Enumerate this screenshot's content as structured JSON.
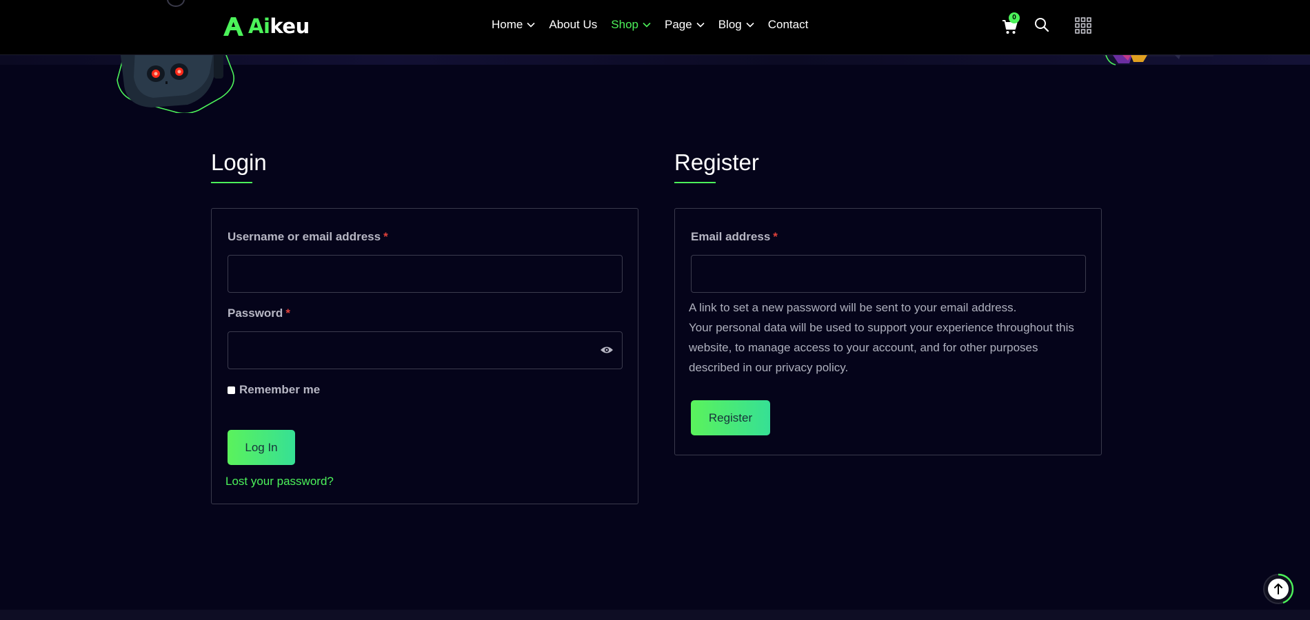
{
  "brand": {
    "logo_prefix": "Ai",
    "logo_suffix": "keu"
  },
  "nav": {
    "items": [
      {
        "label": "Home",
        "has_dropdown": true,
        "active": false
      },
      {
        "label": "About Us",
        "has_dropdown": false,
        "active": false
      },
      {
        "label": "Shop",
        "has_dropdown": true,
        "active": true
      },
      {
        "label": "Page",
        "has_dropdown": true,
        "active": false
      },
      {
        "label": "Blog",
        "has_dropdown": true,
        "active": false
      },
      {
        "label": "Contact",
        "has_dropdown": false,
        "active": false
      }
    ],
    "cart_count": "0",
    "icons": [
      "cart-icon",
      "search-icon",
      "grid-menu-icon"
    ]
  },
  "login": {
    "title": "Login",
    "username_label": "Username or email address",
    "username_value": "",
    "password_label": "Password",
    "password_value": "",
    "required_mark": "*",
    "remember_label": "Remember me",
    "submit_label": "Log In",
    "lost_password_link": "Lost your password?"
  },
  "register": {
    "title": "Register",
    "email_label": "Email address",
    "email_value": "",
    "required_mark": "*",
    "info_line": "A link to set a new password will be sent to your email address.",
    "privacy_text": "Your personal data will be used to support your experience throughout this website, to manage access to your account, and for other purposes described in our privacy policy.",
    "submit_label": "Register"
  },
  "colors": {
    "accent": "#4cf25a",
    "accent_gradient_end": "#36e095",
    "background": "#05041a",
    "header": "#000000",
    "required": "#e0413a"
  }
}
